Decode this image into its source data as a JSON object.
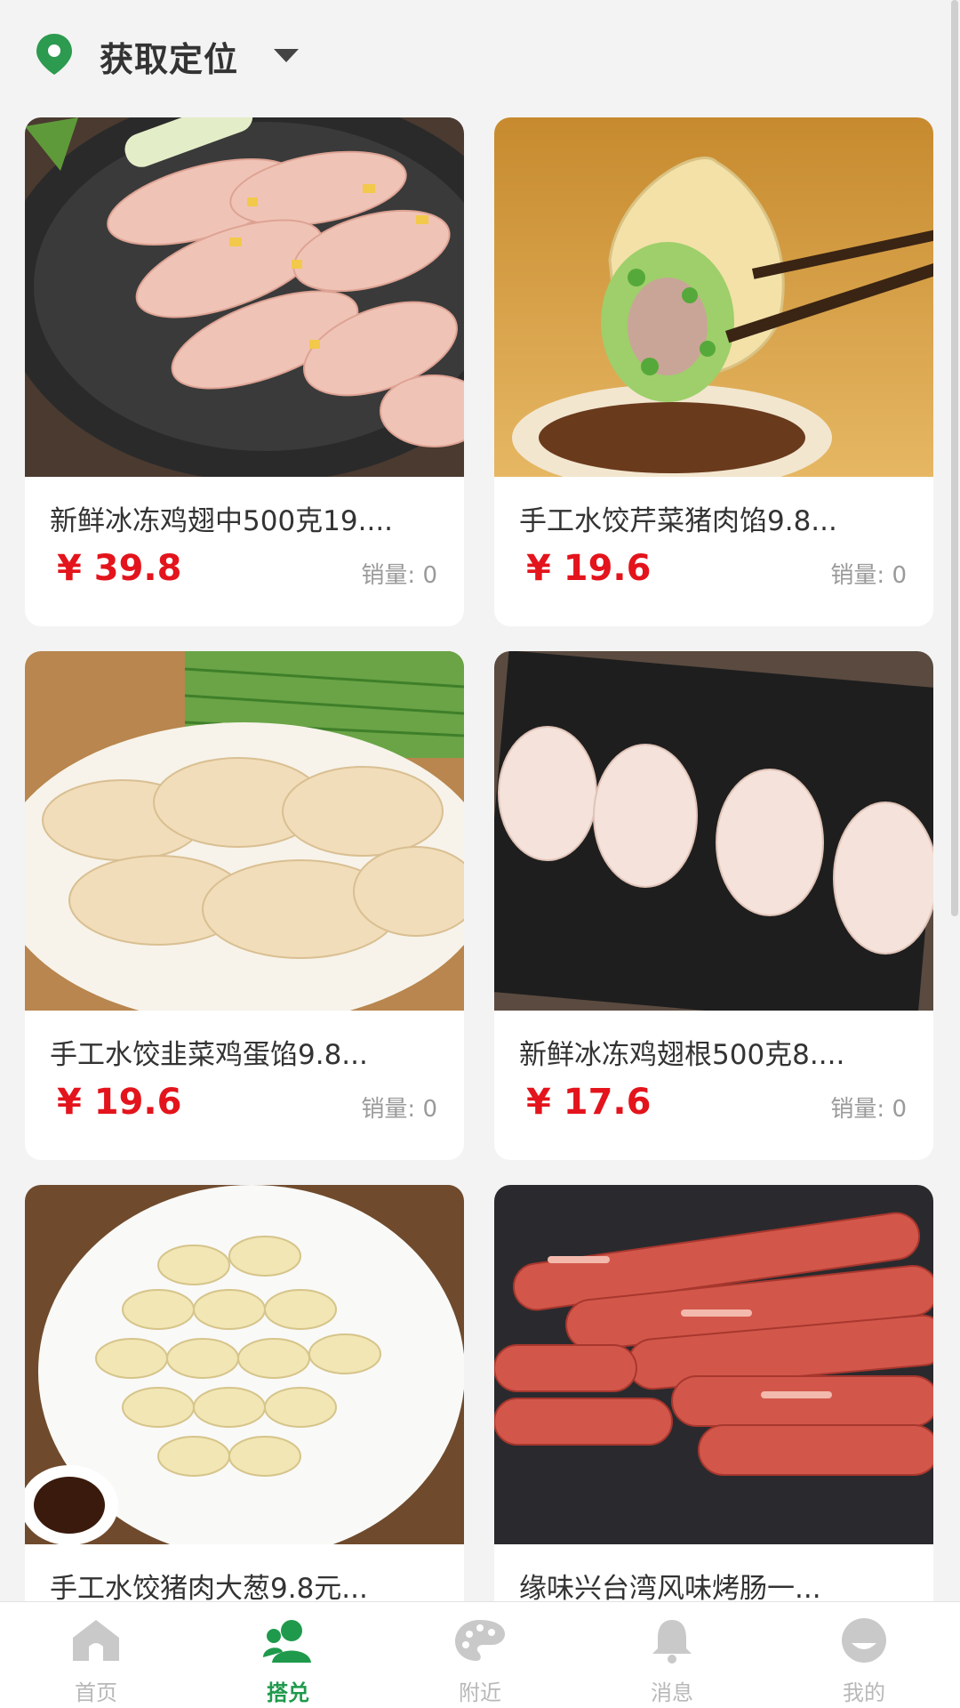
{
  "header": {
    "location_label": "获取定位",
    "location_icon": "map-pin-icon",
    "dropdown_icon": "caret-down-icon"
  },
  "products": [
    {
      "title": "新鲜冰冻鸡翅中500克19....",
      "price": "¥ 39.8",
      "sales": "销量:  0",
      "image": "chicken-wings-on-plate"
    },
    {
      "title": "手工水饺芹菜猪肉馅9.8...",
      "price": "¥ 19.6",
      "sales": "销量:  0",
      "image": "dumpling-with-chopsticks"
    },
    {
      "title": "手工水饺韭菜鸡蛋馅9.8...",
      "price": "¥ 19.6",
      "sales": "销量:  0",
      "image": "dumplings-on-plate"
    },
    {
      "title": "新鲜冰冻鸡翅根500克8....",
      "price": "¥ 17.6",
      "sales": "销量:  0",
      "image": "drumettes-on-tray"
    },
    {
      "title": "手工水饺猪肉大葱9.8元...",
      "price": "",
      "sales": "",
      "image": "raw-dumplings-plate"
    },
    {
      "title": "缘味兴台湾风味烤肠一...",
      "price": "",
      "sales": "",
      "image": "sausages"
    }
  ],
  "tabbar": {
    "items": [
      {
        "label": "首页",
        "icon": "home-icon"
      },
      {
        "label": "搭兑",
        "icon": "users-icon",
        "active": true
      },
      {
        "label": "附近",
        "icon": "palette-icon"
      },
      {
        "label": "消息",
        "icon": "bell-icon"
      },
      {
        "label": "我的",
        "icon": "profile-face-icon"
      }
    ]
  },
  "colors": {
    "accent": "#1f9a4c",
    "price": "#e3141c",
    "background": "#f3f3f3"
  }
}
